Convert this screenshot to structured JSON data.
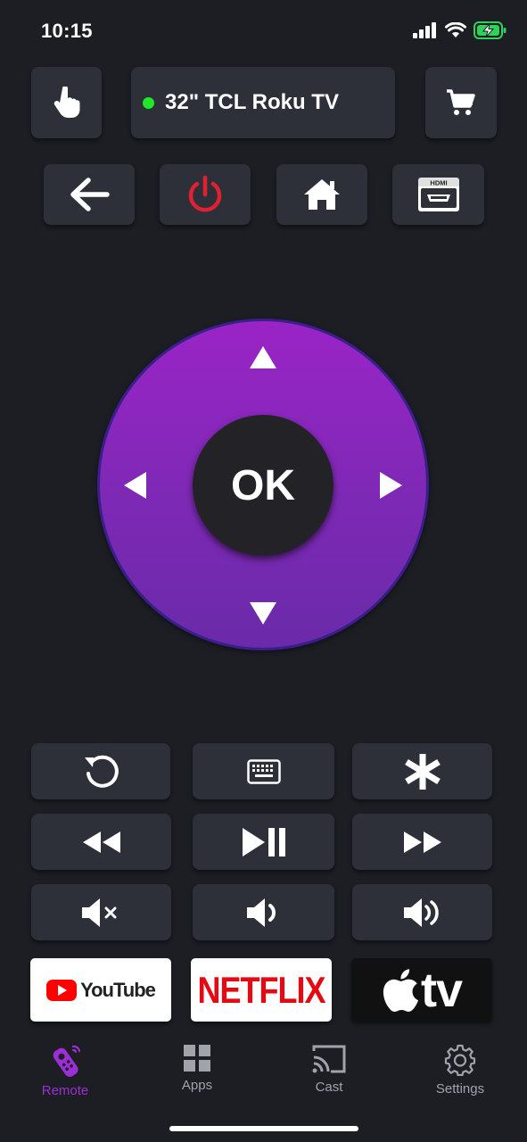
{
  "status_bar": {
    "time": "10:15"
  },
  "device": {
    "name": "32\" TCL Roku TV",
    "connected_color": "#22e628"
  },
  "dpad": {
    "ok_label": "OK"
  },
  "apps": {
    "youtube": {
      "label": "YouTube"
    },
    "netflix": {
      "label": "NETFLIX"
    },
    "appletv": {
      "label": "tv"
    }
  },
  "tabs": [
    {
      "label": "Remote",
      "icon": "remote-icon",
      "active": true
    },
    {
      "label": "Apps",
      "icon": "grid-icon",
      "active": false
    },
    {
      "label": "Cast",
      "icon": "cast-icon",
      "active": false
    },
    {
      "label": "Settings",
      "icon": "gear-icon",
      "active": false
    }
  ],
  "colors": {
    "accent": "#9b2ed6",
    "power": "#e02131",
    "background": "#1c1e24",
    "tile": "#2e3039"
  }
}
